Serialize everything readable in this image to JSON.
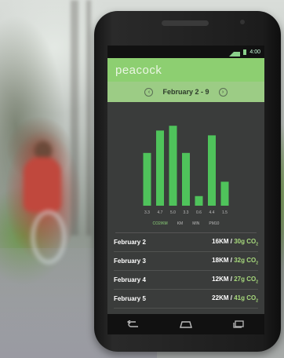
{
  "status": {
    "time": "4:00"
  },
  "app": {
    "name": "peacock"
  },
  "date_nav": {
    "range": "February 2 - 9"
  },
  "chart_data": {
    "type": "bar",
    "categories": [
      "3.3",
      "4.7",
      "5.0",
      "3.3",
      "0.6",
      "4.4",
      "1.5"
    ],
    "values": [
      3.3,
      4.7,
      5.0,
      3.3,
      0.6,
      4.4,
      1.5
    ],
    "ylim": [
      0,
      5.5
    ],
    "bar_color": "#4fc35b"
  },
  "units": [
    "CO2/KM",
    "KM",
    "MIN",
    "PM10"
  ],
  "entries": [
    {
      "date": "February 2",
      "km": "16KM /",
      "co2": "30g CO",
      "sub": "2"
    },
    {
      "date": "February 3",
      "km": "18KM /",
      "co2": "32g CO",
      "sub": "2"
    },
    {
      "date": "February 4",
      "km": "12KM /",
      "co2": "27g CO",
      "sub": "2"
    },
    {
      "date": "February 5",
      "km": "22KM /",
      "co2": "41g CO",
      "sub": "2"
    }
  ],
  "colors": {
    "accent": "#8dcf71",
    "bar": "#4fc35b",
    "screen_bg": "#3a3c3b"
  }
}
